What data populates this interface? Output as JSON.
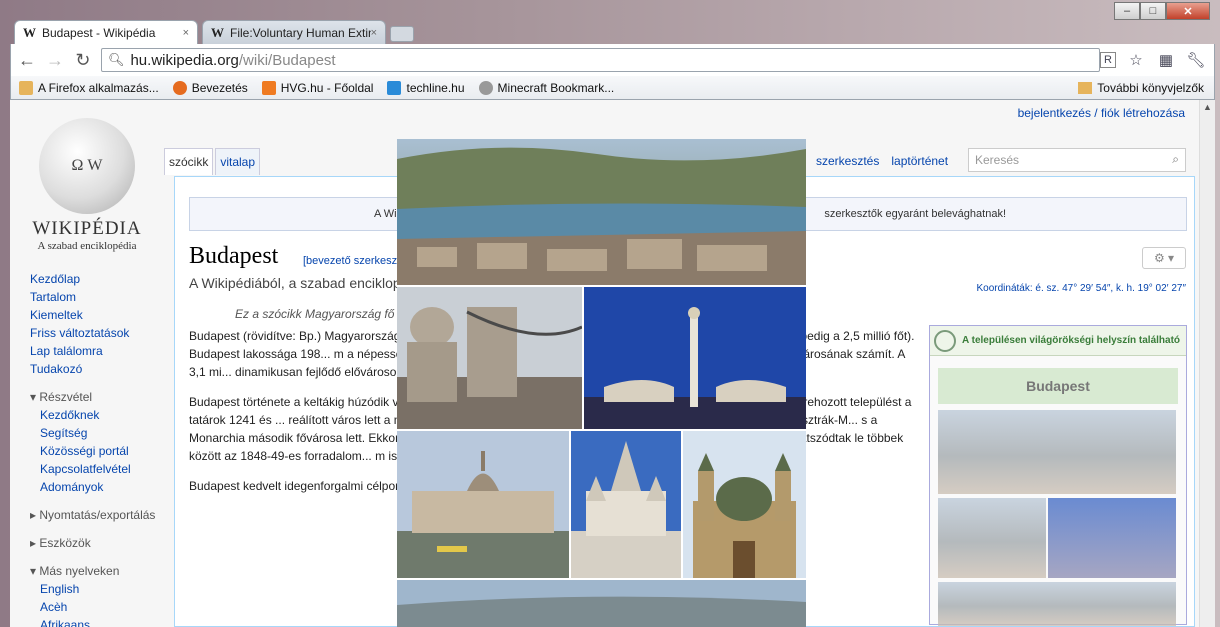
{
  "window": {
    "minimize_icon": "minimize-icon",
    "maximize_icon": "maximize-icon",
    "close_icon": "close-icon"
  },
  "tabs": [
    {
      "title": "Budapest - Wikipédia",
      "active": true,
      "close": "×"
    },
    {
      "title": "File:Voluntary Human Extinc",
      "active": false,
      "close": "×"
    }
  ],
  "toolbar": {
    "url_host": "hu.wikipedia.org",
    "url_path": "/wiki/Budapest",
    "back": "←",
    "forward": "→",
    "reload": "↻"
  },
  "bookmarks": [
    {
      "label": "A Firefox alkalmazás...",
      "color": "#e6b45c"
    },
    {
      "label": "Bevezetés",
      "color": "#e56b1f"
    },
    {
      "label": "HVG.hu - Főoldal",
      "color": "#ef7b22"
    },
    {
      "label": "techline.hu",
      "color": "#2a8bd8"
    },
    {
      "label": "Minecraft Bookmark...",
      "color": "#999999"
    }
  ],
  "bookmarks_other": "További könyvjelzők",
  "page": {
    "login": "bejelentkezés / fiók létrehozása",
    "wordmark": "WIKIPÉDIA",
    "tagline": "A szabad enciklopédia",
    "tab_article": "szócikk",
    "tab_talk": "vitalap",
    "tab_edit": "szerkesztés",
    "tab_history": "laptörténet",
    "search_placeholder": "Keresés",
    "sitenotice_left": "A Wiki",
    "sitenotice_right": "szerkesztők egyaránt belevághatnak!",
    "title": "Budapest",
    "edit_section": "[bevezető szerkeszt",
    "from_wiki": "A Wikipédiából, a szabad enciklopé",
    "coords": "Koordináták: é. sz. 47° 29′ 54″, k. h. 19° 02′ 27″",
    "hatnote": "Ez a szócikk Magyarország fő",
    "unesco": "A településen világörökségi helyszín található",
    "infobox_title": "Budapest"
  },
  "sidebar": {
    "main": [
      "Kezdőlap",
      "Tartalom",
      "Kiemeltek",
      "Friss változtatások",
      "Lap találomra",
      "Tudakozó"
    ],
    "help_header": "Részvétel",
    "help": [
      "Kezdőknek",
      "Segítség",
      "Közösségi portál",
      "Kapcsolatfelvétel",
      "Adományok"
    ],
    "print_header": "Nyomtatás/exportálás",
    "tools_header": "Eszközök",
    "lang_header": "Más nyelveken",
    "langs": [
      "English",
      "Acèh",
      "Afrikaans"
    ]
  },
  "article": {
    "p1": "Budapest (rövidítve: Bp.) Magyarország ... ira, kereskedelem, ipar és közlekedés központja. 2011-ben ... kal együtt pedig a 2,5 millió főt). Budapest lakossága 198... m a népesség csökkenésével is megmaradt Magyaror... vel Magyarország legnagyobb városának számít. A 3,1 mi... dinamikusan fejlődő elővárosok gondoskodnak a meg...",
    "p2": "Budapest története a keltákig húzódik vi... áros neve Aquincum volt, és ez volt a Pannonia pro... Az első ő általuk létrehozott települést a tatárok 1241 és ... reálított város lett a magyarországi reneszánsz humanizm... csak felszabadítását követően, az Osztrák-M... s a Monarchia második fővárosa lett. Ekkor, 1873-ban ... os Budapest név. Ebben az időben épültek meg Budapest ... játszódtak le többek között az 1848-49-es forradalom... m is.",
    "p3": "Budapest kedvelt idegenforgalmi célpon... zül, és 2 millió 700 ezer turista választja úti céljául. Bu... látképe, a Budai"
  },
  "overlay": {
    "photos": [
      "budapest-aerial-photo",
      "chain-bridge-photo",
      "heroes-square-photo",
      "parliament-photo",
      "fishermans-bastion-photo",
      "st-stephens-basilica-photo",
      "danube-panorama-photo"
    ]
  }
}
